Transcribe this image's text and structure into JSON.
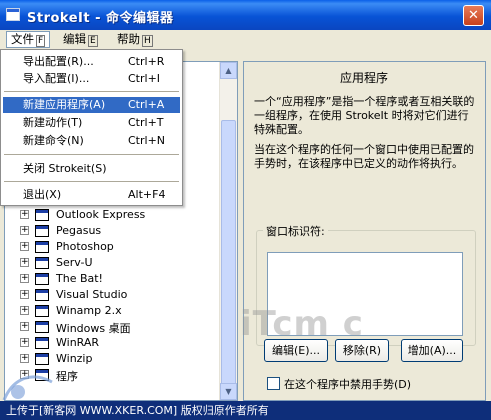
{
  "window": {
    "title": "StrokeIt - 命令编辑器",
    "close_glyph": "✕"
  },
  "menubar": {
    "items": [
      {
        "label": "文件",
        "accel": "F"
      },
      {
        "label": "编辑",
        "accel": "E"
      },
      {
        "label": "帮助",
        "accel": "H"
      }
    ]
  },
  "file_menu": {
    "items": [
      {
        "label": "导出配置(R)...",
        "shortcut": "Ctrl+R"
      },
      {
        "label": "导入配置(I)...",
        "shortcut": "Ctrl+I"
      },
      {
        "label": "新建应用程序(A)",
        "shortcut": "Ctrl+A"
      },
      {
        "label": "新建动作(T)",
        "shortcut": "Ctrl+T"
      },
      {
        "label": "新建命令(N)",
        "shortcut": "Ctrl+N"
      },
      {
        "label": "关闭 Strokeit(S)",
        "shortcut": ""
      },
      {
        "label": "退出(X)",
        "shortcut": "Alt+F4"
      }
    ]
  },
  "tree": {
    "items": [
      {
        "label": "Outlook Express"
      },
      {
        "label": "Pegasus"
      },
      {
        "label": "Photoshop"
      },
      {
        "label": "Serv-U"
      },
      {
        "label": "The Bat!"
      },
      {
        "label": "Visual Studio"
      },
      {
        "label": "Winamp 2.x"
      },
      {
        "label": "Windows 桌面"
      },
      {
        "label": "WinRAR"
      },
      {
        "label": "Winzip"
      },
      {
        "label": "程序"
      }
    ]
  },
  "info": {
    "header": "应用程序",
    "para1": "一个“应用程序”是指一个程序或者互相关联的一组程序，在使用 StrokeIt 时将对它们进行特殊配置。",
    "para2": "当在这个程序的任何一个窗口中使用已配置的手势时，在该程序中已定义的动作将执行。",
    "group_label": "窗口标识符:",
    "edit_button": "编辑(E)...",
    "remove_button": "移除(R)",
    "add_button": "增加(A)...",
    "disable_checkbox_label": "在这个程序中禁用手势(D)"
  },
  "watermark": "iTcm c",
  "footer": "上传于[新客网 WWW.XKER.COM] 版权归原作者所有"
}
